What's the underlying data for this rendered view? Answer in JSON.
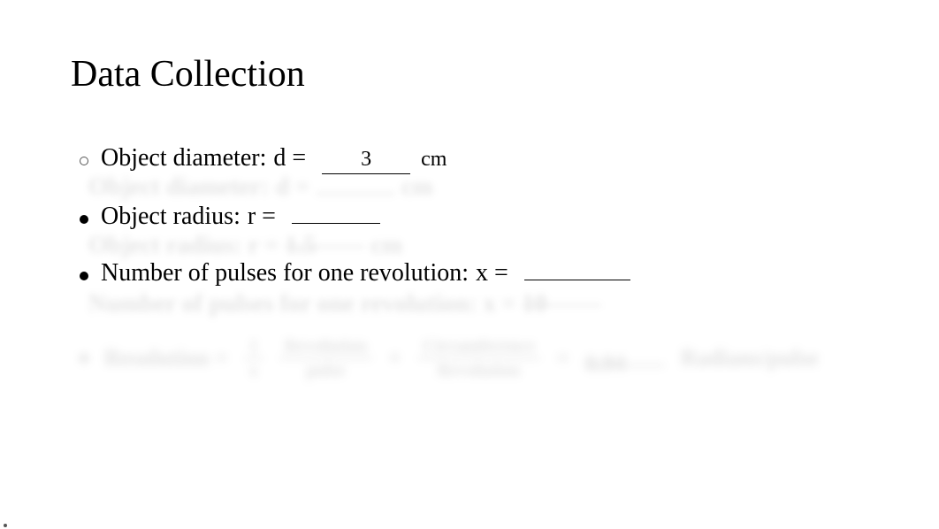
{
  "title": "Data Collection",
  "items": [
    {
      "label": "Object diameter:",
      "var": "d =",
      "value": "3",
      "unit": "cm"
    },
    {
      "label": "Object radius:",
      "var": "r =",
      "value": "",
      "unit": ""
    },
    {
      "label": "Number of pulses for one revolution:",
      "var": "x =",
      "value": "",
      "unit": ""
    }
  ],
  "shadows": {
    "s1": {
      "label": "Object diameter:  d =",
      "unit": "cm"
    },
    "s2": {
      "label": "Object radius:  r =",
      "value": "1.5",
      "unit": "cm"
    },
    "s3": {
      "label": "Number of pulses for one revolution:  x =",
      "value": "10"
    }
  },
  "resolution": {
    "label": "Resolution =",
    "frac1_num": "1",
    "frac1_den": "x",
    "frac2_num": "Revolution",
    "frac2_den": "pulse",
    "frac3_num": "Circumference",
    "frac3_den": "Revolution",
    "value": "0.94",
    "result_unit": "Radians/pulse"
  }
}
